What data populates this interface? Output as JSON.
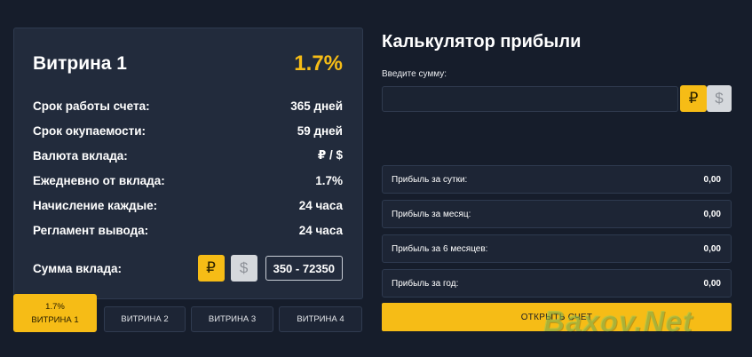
{
  "plan": {
    "title": "Витрина 1",
    "rate": "1.7%",
    "rows": [
      {
        "label": "Срок работы счета:",
        "value": "365 дней"
      },
      {
        "label": "Срок окупаемости:",
        "value": "59 дней"
      },
      {
        "label": "Валюта вклада:",
        "value": "₽ / $"
      },
      {
        "label": "Ежедневно от вклада:",
        "value": "1.7%"
      },
      {
        "label": "Начисление каждые:",
        "value": "24 часа"
      },
      {
        "label": "Регламент вывода:",
        "value": "24 часа"
      }
    ],
    "deposit_label": "Сумма вклада:",
    "currency_rub": "₽",
    "currency_usd": "$",
    "deposit_range": "350 - 72350"
  },
  "tabs": [
    {
      "rate": "1.7%",
      "label": "ВИТРИНА 1"
    },
    {
      "label": "ВИТРИНА 2"
    },
    {
      "label": "ВИТРИНА 3"
    },
    {
      "label": "ВИТРИНА 4"
    }
  ],
  "calculator": {
    "title": "Калькулятор прибыли",
    "amount_label": "Введите сумму:",
    "amount_value": "",
    "currency_rub": "₽",
    "currency_usd": "$",
    "results": [
      {
        "label": "Прибыль за сутки:",
        "value": "0,00"
      },
      {
        "label": "Прибыль за месяц:",
        "value": "0,00"
      },
      {
        "label": "Прибыль за 6 месяцев:",
        "value": "0,00"
      },
      {
        "label": "Прибыль за год:",
        "value": "0,00"
      }
    ],
    "open_button": "ОТКРЫТЬ СЧЕТ"
  },
  "watermark": "Baxov.Net",
  "colors": {
    "background": "#161d2b",
    "card": "#222b3c",
    "accent": "#f6bc16",
    "inactive_button": "#d5d8dc"
  }
}
